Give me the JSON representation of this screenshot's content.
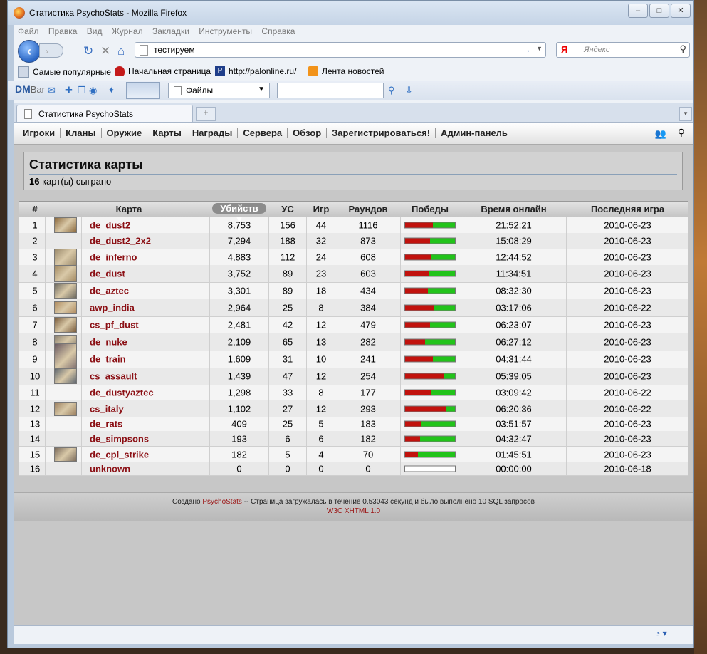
{
  "window": {
    "title": "Статистика PsychoStats - Mozilla Firefox",
    "controls": [
      "–",
      "□",
      "✕"
    ]
  },
  "menu": [
    "Файл",
    "Правка",
    "Вид",
    "Журнал",
    "Закладки",
    "Инструменты",
    "Справка"
  ],
  "navigation": {
    "url": "тестируем",
    "search_placeholder": "Яндекс",
    "search_engine": "Я"
  },
  "bookmarks": [
    "Самые популярные",
    "Начальная страница",
    "http://palonline.ru/",
    "Лента новостей"
  ],
  "dmbar": {
    "logo_dm": "DM",
    "logo_bar": "Bar",
    "files_label": "Файлы"
  },
  "tab": {
    "label": "Статистика PsychoStats",
    "new_tab": "+"
  },
  "site_nav": [
    "Игроки",
    "Кланы",
    "Оружие",
    "Карты",
    "Награды",
    "Сервера",
    "Обзор",
    "Зарегистрироваться!",
    "Админ-панель"
  ],
  "page": {
    "heading": "Статистика карты",
    "played_count": "16",
    "played_text": "карт(ы) сыграно"
  },
  "table": {
    "headers": [
      "#",
      "Карта",
      "Убийств",
      "УС",
      "Игр",
      "Раундов",
      "Победы",
      "Время онлайн",
      "Последняя игра"
    ],
    "rows": [
      {
        "rank": "1",
        "map": "de_dust2",
        "kills": "8,753",
        "hs": "156",
        "games": "44",
        "rounds": "1116",
        "win_ratio": 0.55,
        "online": "21:52:21",
        "last": "2010-06-23",
        "thumb": "#8c6a3e"
      },
      {
        "rank": "2",
        "map": "de_dust2_2x2",
        "kills": "7,294",
        "hs": "188",
        "games": "32",
        "rounds": "873",
        "win_ratio": 0.5,
        "online": "15:08:29",
        "last": "2010-06-23",
        "thumb": ""
      },
      {
        "rank": "3",
        "map": "de_inferno",
        "kills": "4,883",
        "hs": "112",
        "games": "24",
        "rounds": "608",
        "win_ratio": 0.52,
        "online": "12:44:52",
        "last": "2010-06-23",
        "thumb": "#9b8a6c"
      },
      {
        "rank": "4",
        "map": "de_dust",
        "kills": "3,752",
        "hs": "89",
        "games": "23",
        "rounds": "603",
        "win_ratio": 0.48,
        "online": "11:34:51",
        "last": "2010-06-23",
        "thumb": "#a38a62"
      },
      {
        "rank": "5",
        "map": "de_aztec",
        "kills": "3,301",
        "hs": "89",
        "games": "18",
        "rounds": "434",
        "win_ratio": 0.45,
        "online": "08:32:30",
        "last": "2010-06-23",
        "thumb": "#6e6a60"
      },
      {
        "rank": "6",
        "map": "awp_india",
        "kills": "2,964",
        "hs": "25",
        "games": "8",
        "rounds": "384",
        "win_ratio": 0.58,
        "online": "03:17:06",
        "last": "2010-06-22",
        "thumb": "#b08c60"
      },
      {
        "rank": "7",
        "map": "cs_pf_dust",
        "kills": "2,481",
        "hs": "42",
        "games": "12",
        "rounds": "479",
        "win_ratio": 0.5,
        "online": "06:23:07",
        "last": "2010-06-23",
        "thumb": "#7a5c3c"
      },
      {
        "rank": "8",
        "map": "de_nuke",
        "kills": "2,109",
        "hs": "65",
        "games": "13",
        "rounds": "282",
        "win_ratio": 0.4,
        "online": "06:27:12",
        "last": "2010-06-23",
        "thumb": "#8a8070"
      },
      {
        "rank": "9",
        "map": "de_train",
        "kills": "1,609",
        "hs": "31",
        "games": "10",
        "rounds": "241",
        "win_ratio": 0.55,
        "online": "04:31:44",
        "last": "2010-06-23",
        "thumb": "#6a5a62"
      },
      {
        "rank": "10",
        "map": "cs_assault",
        "kills": "1,439",
        "hs": "47",
        "games": "12",
        "rounds": "254",
        "win_ratio": 0.77,
        "online": "05:39:05",
        "last": "2010-06-23",
        "thumb": "#5e6670"
      },
      {
        "rank": "11",
        "map": "de_dustyaztec",
        "kills": "1,298",
        "hs": "33",
        "games": "8",
        "rounds": "177",
        "win_ratio": 0.51,
        "online": "03:09:42",
        "last": "2010-06-22",
        "thumb": ""
      },
      {
        "rank": "12",
        "map": "cs_italy",
        "kills": "1,102",
        "hs": "27",
        "games": "12",
        "rounds": "293",
        "win_ratio": 0.83,
        "online": "06:20:36",
        "last": "2010-06-22",
        "thumb": "#9c8060"
      },
      {
        "rank": "13",
        "map": "de_rats",
        "kills": "409",
        "hs": "25",
        "games": "5",
        "rounds": "183",
        "win_ratio": 0.32,
        "online": "03:51:57",
        "last": "2010-06-23",
        "thumb": ""
      },
      {
        "rank": "14",
        "map": "de_simpsons",
        "kills": "193",
        "hs": "6",
        "games": "6",
        "rounds": "182",
        "win_ratio": 0.3,
        "online": "04:32:47",
        "last": "2010-06-23",
        "thumb": ""
      },
      {
        "rank": "15",
        "map": "de_cpl_strike",
        "kills": "182",
        "hs": "5",
        "games": "4",
        "rounds": "70",
        "win_ratio": 0.25,
        "online": "01:45:51",
        "last": "2010-06-23",
        "thumb": "#7c6c5c"
      },
      {
        "rank": "16",
        "map": "unknown",
        "kills": "0",
        "hs": "0",
        "games": "0",
        "rounds": "0",
        "win_ratio": null,
        "online": "00:00:00",
        "last": "2010-06-18",
        "thumb": ""
      }
    ]
  },
  "footer": {
    "created_by": "Создано",
    "brand": "PsychoStats",
    "load_info": "-- Страница загружалась в течение 0.53043 секунд и было выполнено 10 SQL запросов",
    "w3c": "W3C XHTML 1.0"
  },
  "colors": {
    "win_red": "#c1120d",
    "win_green": "#22c31a",
    "map_link": "#8b0f14"
  }
}
